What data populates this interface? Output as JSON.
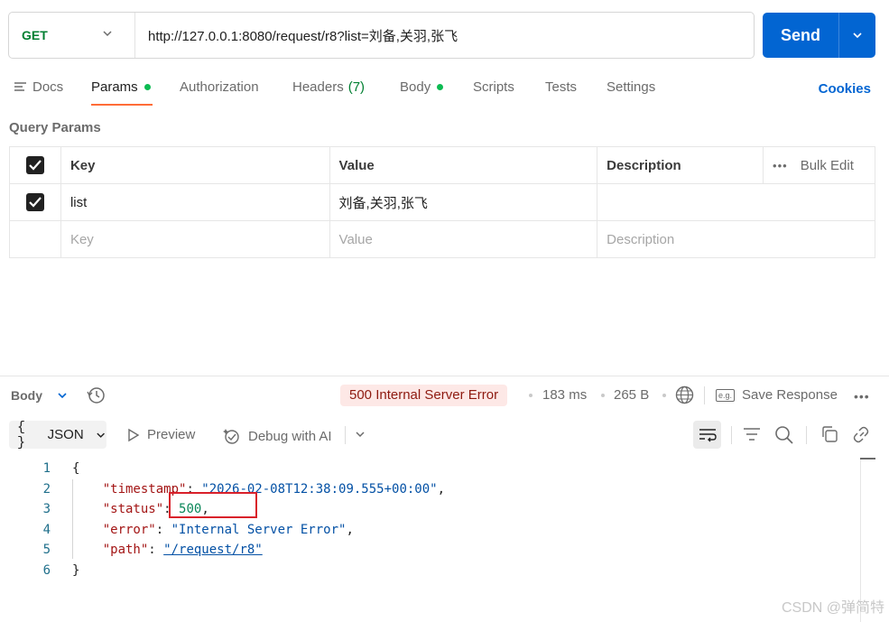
{
  "request": {
    "method": "GET",
    "url": "http://127.0.0.1:8080/request/r8?list=刘备,关羽,张飞",
    "send_label": "Send"
  },
  "tabs": [
    {
      "label": "Docs"
    },
    {
      "label": "Params",
      "active": true
    },
    {
      "label": "Authorization"
    },
    {
      "label": "Headers",
      "count": "(7)"
    },
    {
      "label": "Body"
    },
    {
      "label": "Scripts"
    },
    {
      "label": "Tests"
    },
    {
      "label": "Settings"
    }
  ],
  "cookies_label": "Cookies",
  "query_params": {
    "title": "Query Params",
    "headers": {
      "key": "Key",
      "value": "Value",
      "description": "Description",
      "bulk_edit": "Bulk Edit"
    },
    "rows": [
      {
        "key": "list",
        "value": "刘备,关羽,张飞",
        "description": "",
        "checked": true
      }
    ],
    "placeholders": {
      "key": "Key",
      "value": "Value",
      "description": "Description"
    }
  },
  "response": {
    "body_label": "Body",
    "status": "500 Internal Server Error",
    "time": "183 ms",
    "size": "265 B",
    "save_label": "Save Response",
    "eg_label": "e.g.",
    "format_label": "JSON",
    "preview_label": "Preview",
    "debug_label": "Debug with AI",
    "lines": [
      {
        "n": "1",
        "t": "{"
      },
      {
        "n": "2",
        "key": "\"timestamp\"",
        "val": "\"2026-02-08T12:38:09.555+00:00\"",
        "kind": "str",
        "comma": ","
      },
      {
        "n": "3",
        "key": "\"status\"",
        "val": "500",
        "kind": "num",
        "comma": ","
      },
      {
        "n": "4",
        "key": "\"error\"",
        "val": "\"Internal Server Error\"",
        "kind": "str",
        "comma": ","
      },
      {
        "n": "5",
        "key": "\"path\"",
        "val": "\"/request/r8\"",
        "kind": "link",
        "comma": ""
      },
      {
        "n": "6",
        "t": "}"
      }
    ]
  },
  "watermark": "CSDN @弹简特",
  "colors": {
    "accent": "#0265d2",
    "tab_indicator": "#ff6c37",
    "status_error_bg": "#fde8e6",
    "status_error_text": "#8e1a10",
    "method": "#007f31"
  }
}
